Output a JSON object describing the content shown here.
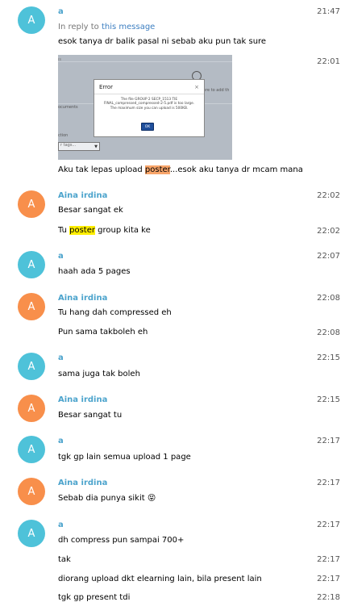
{
  "messages": [
    {
      "sender": "a",
      "avatar": "A",
      "time": "21:47",
      "reply_prefix": "In reply to ",
      "reply_link": "this message",
      "text": "esok tanya dr balik pasal ni sebab aku pun tak sure"
    },
    {
      "time": "22:01",
      "image": {
        "dialog_title": "Error",
        "dialog_close": "×",
        "dialog_message": "The file GROUP 2 SECP_1513 TIE FINAL_compressed_compressed-2-5.pdf is too large. The maximum size you can upload is 500KB.",
        "ok_label": "OK",
        "bg_text_right": "ere to add th",
        "bg_text_left": "ocuments",
        "bg_text_section": "ction",
        "select_placeholder": "r tags..."
      },
      "text_before": "Aku tak lepas upload ",
      "highlight": "poster",
      "text_after": "...esok aku tanya dr mcam mana"
    },
    {
      "sender": "Aina irdina",
      "avatar": "A",
      "time": "22:02",
      "text": "Besar sangat ek"
    },
    {
      "time": "22:02",
      "text_before": "Tu ",
      "highlight": "poster",
      "text_after": " group kita ke"
    },
    {
      "sender": "a",
      "avatar": "A",
      "time": "22:07",
      "text": "haah ada 5 pages"
    },
    {
      "sender": "Aina irdina",
      "avatar": "A",
      "time": "22:08",
      "text": "Tu hang dah compressed eh"
    },
    {
      "time": "22:08",
      "text": "Pun sama takboleh eh"
    },
    {
      "sender": "a",
      "avatar": "A",
      "time": "22:15",
      "text": "sama juga tak boleh"
    },
    {
      "sender": "Aina irdina",
      "avatar": "A",
      "time": "22:15",
      "text": "Besar sangat tu"
    },
    {
      "sender": "a",
      "avatar": "A",
      "time": "22:17",
      "text": "tgk gp lain semua upload 1 page"
    },
    {
      "sender": "Aina irdina",
      "avatar": "A",
      "time": "22:17",
      "text": "Sebab dia punya sikit",
      "emoji": "😝"
    },
    {
      "sender": "a",
      "avatar": "A",
      "time": "22:17",
      "text": "dh compress pun sampai 700+"
    },
    {
      "time": "22:17",
      "text": "tak"
    },
    {
      "time": "22:17",
      "text": "diorang upload dkt elearning lain, bila present lain"
    },
    {
      "time": "22:18",
      "text": "tgk gp present tdi"
    }
  ],
  "colors": {
    "avatar_a": "#4ec2d9",
    "avatar_aina": "#f88f4b",
    "name": "#4ba3cc",
    "highlight_orange": "#f8a56a",
    "highlight_yellow": "#ffee00"
  }
}
